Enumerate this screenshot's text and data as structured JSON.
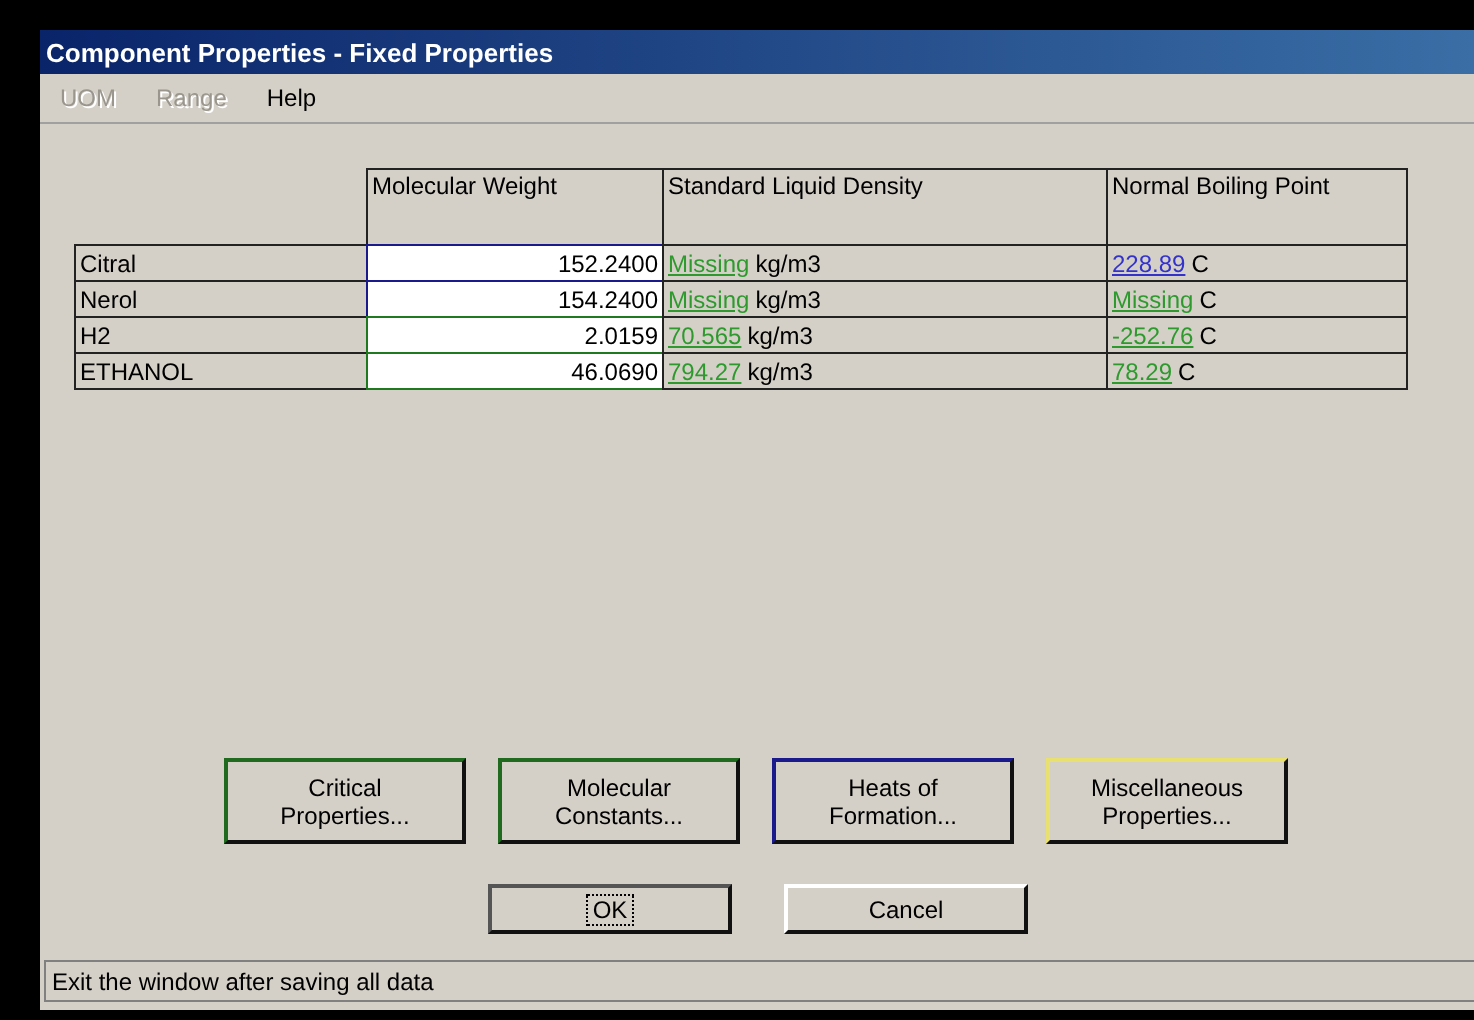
{
  "window": {
    "title": "Component Properties - Fixed Properties"
  },
  "menu": [
    {
      "label": "UOM",
      "disabled": true
    },
    {
      "label": "Range",
      "disabled": true
    },
    {
      "label": "Help",
      "disabled": false
    }
  ],
  "table": {
    "columns": [
      "Molecular Weight",
      "Standard Liquid Density",
      "Normal Boiling Point"
    ],
    "rows": [
      {
        "name": "Citral",
        "molecular_weight": {
          "value": "152.2400",
          "color": "#1a1a8c"
        },
        "density": {
          "value": "Missing",
          "unit": "kg/m3",
          "color": "#2e9a2e"
        },
        "boiling_point": {
          "value": "228.89",
          "unit": "C",
          "color": "#3333cc"
        }
      },
      {
        "name": "Nerol",
        "molecular_weight": {
          "value": "154.2400",
          "color": "#1a1a8c"
        },
        "density": {
          "value": "Missing",
          "unit": "kg/m3",
          "color": "#2e9a2e"
        },
        "boiling_point": {
          "value": "Missing",
          "unit": "C",
          "color": "#2e9a2e"
        }
      },
      {
        "name": "H2",
        "molecular_weight": {
          "value": "2.0159",
          "color": "#1f7a1f"
        },
        "density": {
          "value": "70.565",
          "unit": "kg/m3",
          "color": "#2e9a2e"
        },
        "boiling_point": {
          "value": "-252.76",
          "unit": "C",
          "color": "#2e9a2e"
        }
      },
      {
        "name": "ETHANOL",
        "molecular_weight": {
          "value": "46.0690",
          "color": "#1f7a1f"
        },
        "density": {
          "value": "794.27",
          "unit": "kg/m3",
          "color": "#2e9a2e"
        },
        "boiling_point": {
          "value": "78.29",
          "unit": "C",
          "color": "#2e9a2e"
        }
      }
    ]
  },
  "property_buttons": [
    {
      "label": "Critical\nProperties...",
      "color": "#1f6a1f"
    },
    {
      "label": "Molecular\nConstants...",
      "color": "#1f6a1f"
    },
    {
      "label": "Heats of\nFormation...",
      "color": "#1a1a8c"
    },
    {
      "label": "Miscellaneous\nProperties...",
      "color": "#e8e070"
    }
  ],
  "dialog_buttons": [
    {
      "label": "OK",
      "focused": true
    },
    {
      "label": "Cancel",
      "focused": false
    }
  ],
  "status_bar": "Exit the window after saving all data"
}
